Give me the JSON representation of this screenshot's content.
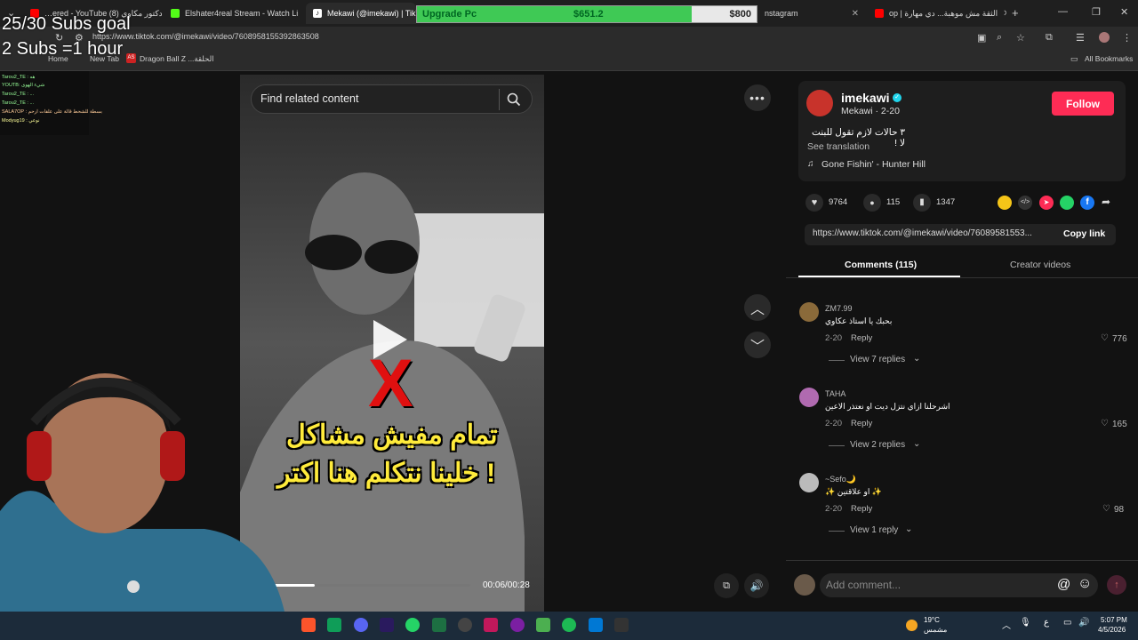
{
  "browser": {
    "tabs": [
      {
        "label": "…ered - YouTube دكتور مكاوي (8)",
        "favicon_color": "#ff0000"
      },
      {
        "label": "Elshater4real Stream - Watch Li",
        "favicon_color": "#53fc18"
      },
      {
        "label": "Mekawi (@imekawi) | TikTo",
        "favicon_color": "#000000"
      },
      {
        "label": "nstagram",
        "favicon_color": "#e1306c"
      },
      {
        "label": "op | الثقة مش موهبة... دي مهارة",
        "favicon_color": "#ff0000"
      }
    ],
    "url": "https://www.tiktok.com/@imekawi/video/7608958155392863508",
    "bookmarks": [
      "Home",
      "New Tab",
      "Dragon Ball Z ...الحلقة"
    ],
    "all_bookmarks": "All Bookmarks",
    "new_tab_glyph": "+"
  },
  "upgrade_bar": {
    "label": "Upgrade Pc",
    "current": "$651.2",
    "goal": "$800",
    "progress_fraction": 0.81
  },
  "stream_overlay": {
    "goal_line1": "25/30 Subs goal",
    "goal_line2": "2 Subs =1 hour",
    "chat": [
      "Tarou2_TE : هه",
      "YOUTB: شيء الهوى",
      "Tarou2_TE : ...",
      "Tarou2_TE : ...",
      "SALA7OP : بسطة للشحط قالة على علقات ارحم",
      "Modyug19 : نوعي"
    ]
  },
  "video": {
    "search_placeholder": "Find related content",
    "caption_line1": "تمام مفيش مشاكل",
    "caption_line2": "خلينا نتكلم هنا اكتر !",
    "x_mark": "X",
    "time": "00:06/00:28",
    "progress_fraction": 0.21
  },
  "post": {
    "username": "imekawi",
    "display": "Mekawi · 2-20",
    "description": "٣ حالات لازم تقول للبنت لا !",
    "see_translation": "See translation",
    "music": "Gone Fishin' - Hunter Hill",
    "follow_label": "Follow",
    "likes": "9764",
    "comments_count": "115",
    "saves": "1347",
    "link": "https://www.tiktok.com/@imekawi/video/76089581553...",
    "copy_label": "Copy link"
  },
  "tabs": {
    "comments": "Comments (115)",
    "creator_videos": "Creator videos"
  },
  "comments": [
    {
      "name": "ZM7.99",
      "text": "بحبك يا استاذ عكاوي",
      "date": "2-20",
      "reply": "Reply",
      "likes": "776",
      "view_replies": "View 7 replies",
      "avatar_color": "#8a6a3a"
    },
    {
      "name": "TAHA",
      "text": "اشرحلنا ازاي نتزل ديت او نعتذر الاعين",
      "date": "2-20",
      "reply": "Reply",
      "likes": "165",
      "view_replies": "View 2 replies",
      "avatar_color": "#b06ab0"
    },
    {
      "name": "~Sefo🌙",
      "text": "✨ او علاقتين ✨",
      "date": "2-20",
      "reply": "Reply",
      "likes": "98",
      "view_replies": "View 1 reply",
      "avatar_color": "#bbbbbb"
    }
  ],
  "comment_input": {
    "placeholder": "Add comment..."
  },
  "taskbar": {
    "weather_temp": "19°C",
    "weather_desc": "مشمس",
    "time": "5:07 PM",
    "date": "4/5/2026",
    "lang": "ع"
  }
}
